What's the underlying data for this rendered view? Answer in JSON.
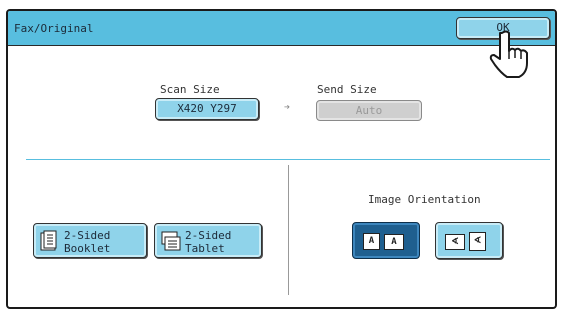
{
  "window": {
    "title": "Fax/Original",
    "ok_label": "OK"
  },
  "scan_size": {
    "label": "Scan Size",
    "value": "X420 Y297"
  },
  "send_size": {
    "label": "Send Size",
    "value": "Auto"
  },
  "two_sided": {
    "booklet_label": "2-Sided\nBooklet",
    "tablet_label": "2-Sided\nTablet"
  },
  "orientation": {
    "label": "Image Orientation",
    "options": [
      {
        "name": "upright",
        "glyphs": [
          "A",
          "A"
        ],
        "selected": true
      },
      {
        "name": "rotated",
        "glyphs": [
          "∢",
          "∢"
        ],
        "selected": false
      }
    ]
  },
  "icons": {
    "cursor": "hand-pointer-icon",
    "arrow": "arrow-right-icon",
    "booklet": "booklet-icon",
    "tablet": "tablet-icon"
  },
  "colors": {
    "titlebar": "#58bedf",
    "button": "#8fd3ea",
    "selected": "#1f5f8f",
    "divider": "#58bedf"
  }
}
